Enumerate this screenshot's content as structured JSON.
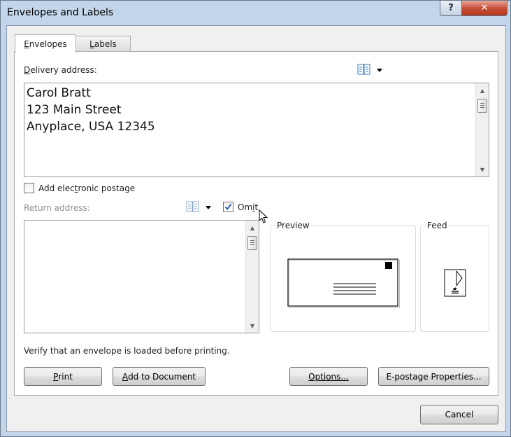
{
  "window": {
    "title": "Envelopes and Labels",
    "help_glyph": "?",
    "close_glyph": "✕"
  },
  "tabs": {
    "envelopes": "Envelopes",
    "envelopes_key": "E",
    "envelopes_rest": "nvelopes",
    "labels": "Labels",
    "labels_key": "L",
    "labels_rest": "abels"
  },
  "delivery": {
    "label_key": "D",
    "label_rest": "elivery address:",
    "address": "Carol Bratt\n123 Main Street\nAnyplace, USA 12345",
    "address_book_icon": "address-book-icon"
  },
  "postage": {
    "label_pre": "Add elec",
    "label_key": "t",
    "label_post": "ronic postage",
    "checked": false
  },
  "return": {
    "label": "Return address:",
    "address": "",
    "omit_pre": "Om",
    "omit_key": "i",
    "omit_post": "t",
    "omit_checked": true
  },
  "preview": {
    "label": "Preview"
  },
  "feed": {
    "label": "Feed"
  },
  "status": {
    "message": "Verify that an envelope is loaded before printing."
  },
  "buttons": {
    "print_key": "P",
    "print_rest": "rint",
    "add_key": "A",
    "add_rest": "dd to Document",
    "options_key": "O",
    "options_rest": "ptions...",
    "epostage_label": "E-postage Properties...",
    "cancel": "Cancel"
  },
  "colors": {
    "close_red": "#c44a33",
    "check_blue": "#1c4fa8",
    "disabled_text": "#8f8f8f"
  }
}
